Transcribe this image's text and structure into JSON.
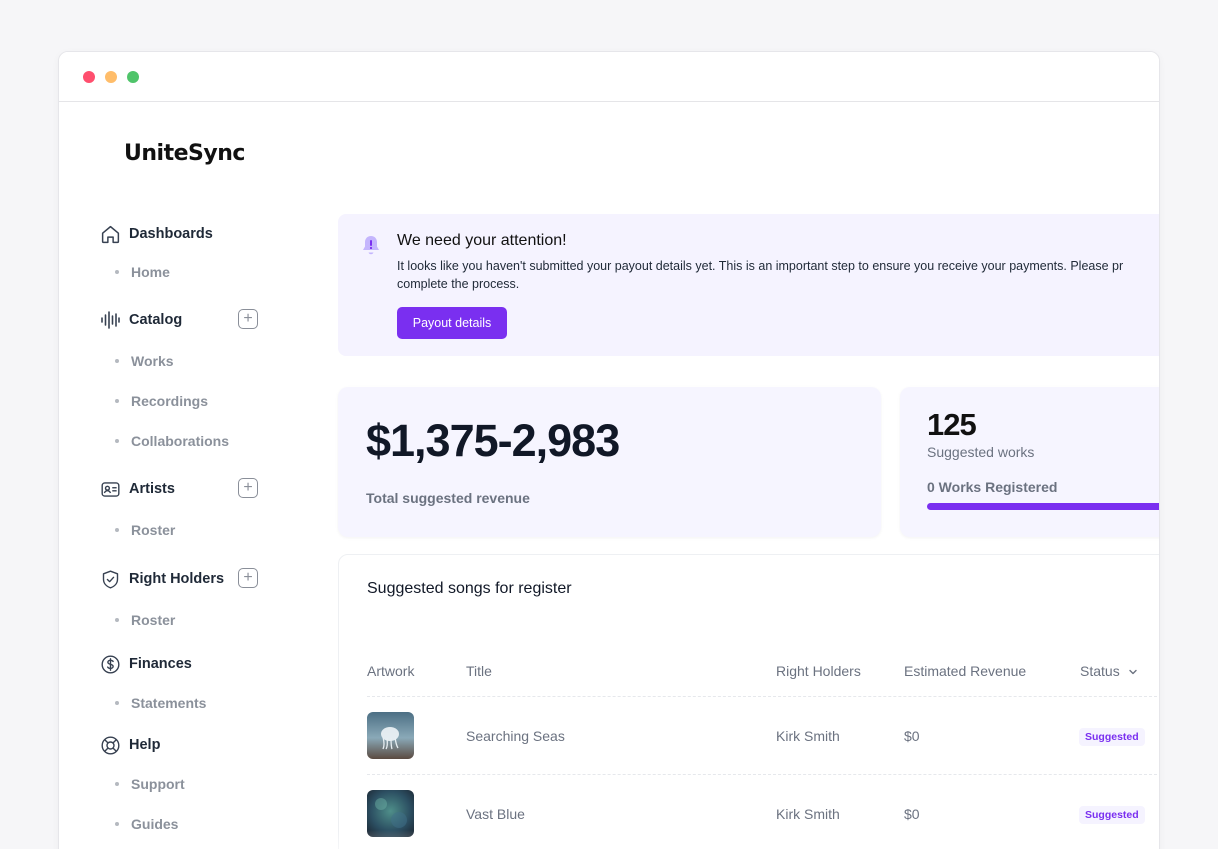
{
  "window": {
    "controls": [
      "close",
      "minimize",
      "maximize"
    ]
  },
  "brand": {
    "name": "UniteSync"
  },
  "sidebar": {
    "groups": [
      {
        "label": "Dashboards",
        "icon": "home-icon",
        "add": false,
        "items": [
          "Home"
        ]
      },
      {
        "label": "Catalog",
        "icon": "audio-wave-icon",
        "add": true,
        "items": [
          "Works",
          "Recordings",
          "Collaborations"
        ]
      },
      {
        "label": "Artists",
        "icon": "contact-card-icon",
        "add": true,
        "items": [
          "Roster"
        ]
      },
      {
        "label": "Right Holders",
        "icon": "shield-check-icon",
        "add": true,
        "items": [
          "Roster"
        ]
      },
      {
        "label": "Finances",
        "icon": "dollar-circle-icon",
        "add": false,
        "items": [
          "Statements"
        ]
      },
      {
        "label": "Help",
        "icon": "lifebuoy-icon",
        "add": false,
        "items": [
          "Support",
          "Guides"
        ]
      }
    ]
  },
  "alert": {
    "title": "We need your attention!",
    "text": "It looks like you haven't submitted your payout details yet. This is an important step to ensure you receive your payments. Please pr",
    "text_line2": "complete the process.",
    "button_label": "Payout details",
    "icon": "bell-icon"
  },
  "stats": {
    "revenue_value": "$1,375-2,983",
    "revenue_caption": "Total suggested revenue",
    "works_count": "125",
    "works_caption": "Suggested works",
    "registered_caption": "0 Works Registered",
    "accent": "#7a2ff0"
  },
  "table": {
    "title": "Suggested songs for register",
    "columns": [
      "Artwork",
      "Title",
      "Right Holders",
      "Estimated Revenue",
      "Status"
    ],
    "rows": [
      {
        "title": "Searching Seas",
        "right_holders": "Kirk Smith",
        "revenue": "$0",
        "status": "Suggested"
      },
      {
        "title": "Vast Blue",
        "right_holders": "Kirk Smith",
        "revenue": "$0",
        "status": "Suggested"
      }
    ]
  }
}
